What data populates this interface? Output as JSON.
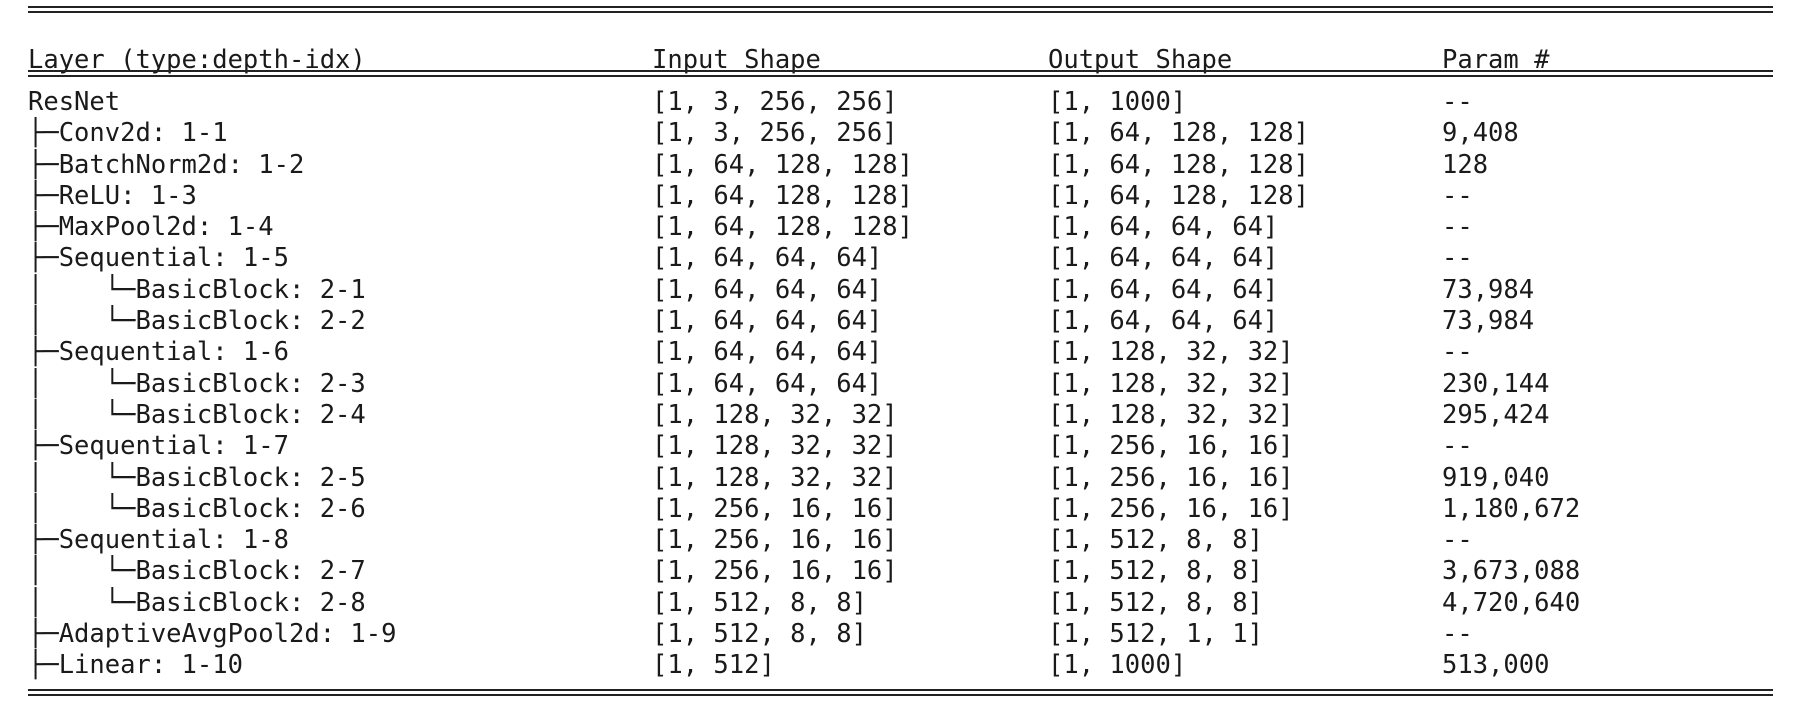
{
  "columns": [
    "Layer (type:depth-idx)",
    "Input Shape",
    "Output Shape",
    "Param #"
  ],
  "rows": [
    [
      "ResNet",
      "[1, 3, 256, 256]",
      "[1, 1000]",
      "--"
    ],
    [
      "├─Conv2d: 1-1",
      "[1, 3, 256, 256]",
      "[1, 64, 128, 128]",
      "9,408"
    ],
    [
      "├─BatchNorm2d: 1-2",
      "[1, 64, 128, 128]",
      "[1, 64, 128, 128]",
      "128"
    ],
    [
      "├─ReLU: 1-3",
      "[1, 64, 128, 128]",
      "[1, 64, 128, 128]",
      "--"
    ],
    [
      "├─MaxPool2d: 1-4",
      "[1, 64, 128, 128]",
      "[1, 64, 64, 64]",
      "--"
    ],
    [
      "├─Sequential: 1-5",
      "[1, 64, 64, 64]",
      "[1, 64, 64, 64]",
      "--"
    ],
    [
      "│    └─BasicBlock: 2-1",
      "[1, 64, 64, 64]",
      "[1, 64, 64, 64]",
      "73,984"
    ],
    [
      "│    └─BasicBlock: 2-2",
      "[1, 64, 64, 64]",
      "[1, 64, 64, 64]",
      "73,984"
    ],
    [
      "├─Sequential: 1-6",
      "[1, 64, 64, 64]",
      "[1, 128, 32, 32]",
      "--"
    ],
    [
      "│    └─BasicBlock: 2-3",
      "[1, 64, 64, 64]",
      "[1, 128, 32, 32]",
      "230,144"
    ],
    [
      "│    └─BasicBlock: 2-4",
      "[1, 128, 32, 32]",
      "[1, 128, 32, 32]",
      "295,424"
    ],
    [
      "├─Sequential: 1-7",
      "[1, 128, 32, 32]",
      "[1, 256, 16, 16]",
      "--"
    ],
    [
      "│    └─BasicBlock: 2-5",
      "[1, 128, 32, 32]",
      "[1, 256, 16, 16]",
      "919,040"
    ],
    [
      "│    └─BasicBlock: 2-6",
      "[1, 256, 16, 16]",
      "[1, 256, 16, 16]",
      "1,180,672"
    ],
    [
      "├─Sequential: 1-8",
      "[1, 256, 16, 16]",
      "[1, 512, 8, 8]",
      "--"
    ],
    [
      "│    └─BasicBlock: 2-7",
      "[1, 256, 16, 16]",
      "[1, 512, 8, 8]",
      "3,673,088"
    ],
    [
      "│    └─BasicBlock: 2-8",
      "[1, 512, 8, 8]",
      "[1, 512, 8, 8]",
      "4,720,640"
    ],
    [
      "├─AdaptiveAvgPool2d: 1-9",
      "[1, 512, 8, 8]",
      "[1, 512, 1, 1]",
      "--"
    ],
    [
      "├─Linear: 1-10",
      "[1, 512]",
      "[1, 1000]",
      "513,000"
    ]
  ]
}
